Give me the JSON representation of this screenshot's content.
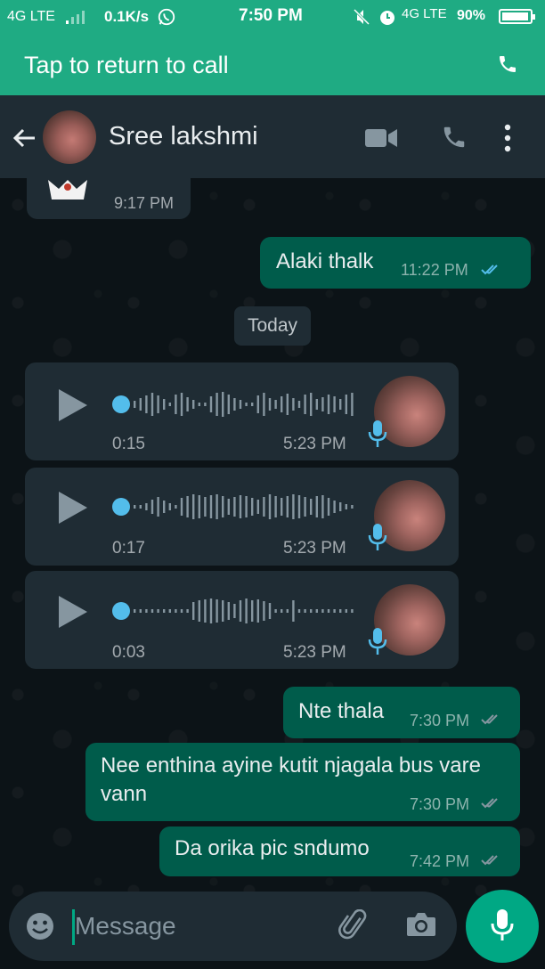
{
  "status_bar": {
    "network_left": "4G LTE",
    "speed": "0.1K/s",
    "time": "7:50 PM",
    "network_right": "4G LTE",
    "battery": "90%"
  },
  "call_banner": {
    "text": "Tap to return to call",
    "icon": "phone-icon"
  },
  "header": {
    "contact_name": "Sree lakshmi",
    "icons": [
      "back-arrow-icon",
      "video-call-icon",
      "voice-call-icon",
      "more-options-icon"
    ]
  },
  "messages": [
    {
      "type": "incoming_media",
      "time": "9:17 PM"
    },
    {
      "type": "outgoing",
      "text": "Alaki thalk",
      "time": "11:22 PM",
      "status": "read"
    }
  ],
  "date_chip": "Today",
  "voice_notes": [
    {
      "duration": "0:15",
      "time": "5:23 PM",
      "progress": 0
    },
    {
      "duration": "0:17",
      "time": "5:23 PM",
      "progress": 0
    },
    {
      "duration": "0:03",
      "time": "5:23 PM",
      "progress": 0
    }
  ],
  "outgoing_messages": [
    {
      "text": "Nte thala",
      "time": "7:30 PM",
      "status": "read"
    },
    {
      "text": "Nee enthina ayine kutit njagala bus vare vann",
      "time": "7:30 PM",
      "status": "read"
    },
    {
      "text": "Da orika pic sndumo",
      "time": "7:42 PM",
      "status": "read"
    }
  ],
  "composer": {
    "placeholder": "Message",
    "icons": [
      "emoji-icon",
      "attach-icon",
      "camera-icon",
      "mic-icon"
    ]
  },
  "colors": {
    "accent": "#00a884",
    "banner": "#1fab83",
    "outgoing_bubble": "#005c4b",
    "incoming_bubble": "#1f2c34",
    "read_ticks": "#53bdeb"
  }
}
